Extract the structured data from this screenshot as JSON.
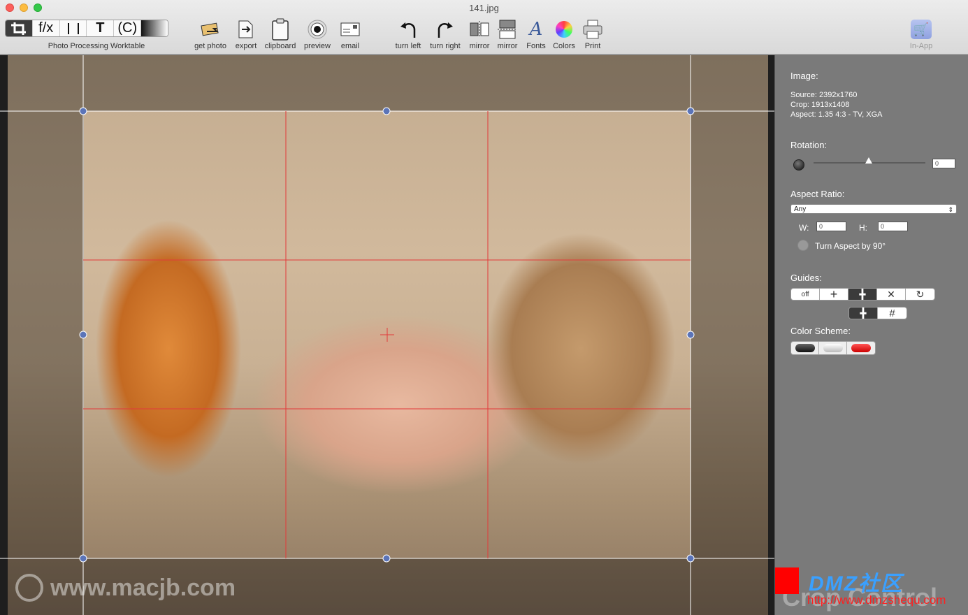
{
  "window": {
    "title": "141.jpg"
  },
  "toolbar": {
    "segments": [
      "f/x",
      "T",
      "(C)"
    ],
    "segments_label": "Photo Processing Worktable",
    "items": [
      {
        "label": "get photo",
        "icon": "get-photo-icon"
      },
      {
        "label": "export",
        "icon": "export-icon"
      },
      {
        "label": "clipboard",
        "icon": "clipboard-icon"
      },
      {
        "label": "preview",
        "icon": "eye-icon"
      },
      {
        "label": "email",
        "icon": "envelope-icon"
      },
      {
        "label": "turn left",
        "icon": "rotate-left-icon"
      },
      {
        "label": "turn right",
        "icon": "rotate-right-icon"
      },
      {
        "label": "mirror",
        "icon": "mirror-horizontal-icon"
      },
      {
        "label": "mirror",
        "icon": "mirror-vertical-icon"
      },
      {
        "label": "Fonts",
        "icon": "font-icon"
      },
      {
        "label": "Colors",
        "icon": "color-wheel-icon"
      },
      {
        "label": "Print",
        "icon": "printer-icon"
      }
    ],
    "in_app": "In-App"
  },
  "panel": {
    "image_heading": "Image:",
    "source": "Source: 2392x1760",
    "crop": "Crop: 1913x1408",
    "aspect": "Aspect: 1.35 4:3 - TV, XGA",
    "rotation_heading": "Rotation:",
    "rotation_value": "0",
    "aspect_ratio_heading": "Aspect Ratio:",
    "aspect_select": "Any",
    "w_label": "W:",
    "w_value": "0",
    "h_label": "H:",
    "h_value": "0",
    "turn_aspect": "Turn Aspect by 90°",
    "guides_heading": "Guides:",
    "guides_off": "off",
    "color_scheme_heading": "Color Scheme:"
  },
  "watermarks": {
    "macjb": "www.macjb.com",
    "dmz": "DMZ社区",
    "dmz_url": "http://www.dmzshequ.com",
    "crop_control": "Crop Control"
  },
  "colors": {
    "guide_red": "#e23a3a",
    "handle": "#5b74b8"
  }
}
